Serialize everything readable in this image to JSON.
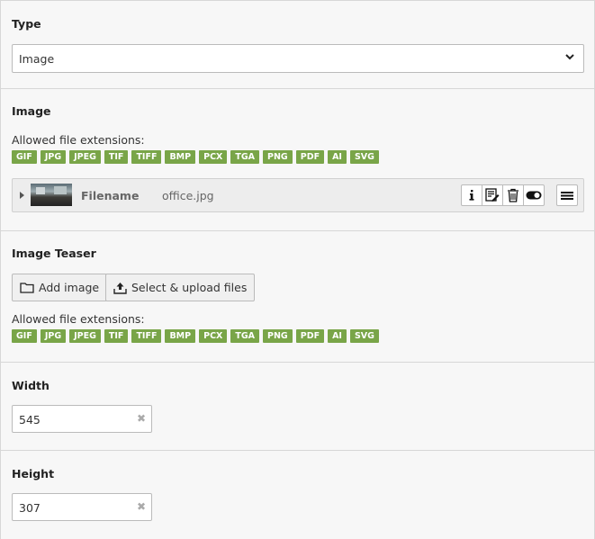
{
  "type_section": {
    "label": "Type",
    "selected": "Image"
  },
  "image_section": {
    "label": "Image",
    "allowed_label": "Allowed file extensions:",
    "extensions": [
      "GIF",
      "JPG",
      "JPEG",
      "TIF",
      "TIFF",
      "BMP",
      "PCX",
      "TGA",
      "PNG",
      "PDF",
      "AI",
      "SVG"
    ],
    "file": {
      "field_label": "Filename",
      "value": "office.jpg"
    },
    "actions": [
      "info-icon",
      "edit-metadata-icon",
      "delete-icon",
      "toggle-visibility-icon",
      "drag-handle-icon"
    ]
  },
  "teaser_section": {
    "label": "Image Teaser",
    "add_button": "Add image",
    "upload_button": "Select & upload files",
    "allowed_label": "Allowed file extensions:",
    "extensions": [
      "GIF",
      "JPG",
      "JPEG",
      "TIF",
      "TIFF",
      "BMP",
      "PCX",
      "TGA",
      "PNG",
      "PDF",
      "AI",
      "SVG"
    ]
  },
  "width_section": {
    "label": "Width",
    "value": "545"
  },
  "height_section": {
    "label": "Height",
    "value": "307"
  },
  "colors": {
    "extension_badge": "#79a548",
    "background": "#f7f7f7",
    "border": "#d7d7d7"
  }
}
